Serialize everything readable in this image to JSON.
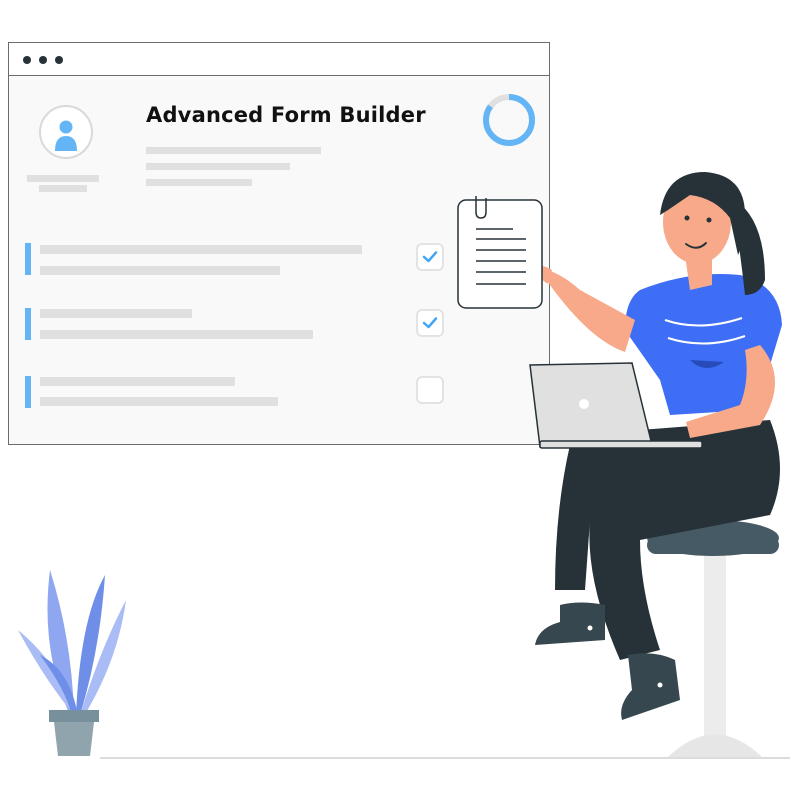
{
  "window": {
    "title": "Advanced Form Builder"
  },
  "form_rows": [
    {
      "checked": true
    },
    {
      "checked": true
    },
    {
      "checked": false
    }
  ],
  "progress": {
    "fraction": 0.85
  },
  "icons": {
    "window_controls": "three-dots",
    "avatar": "user-icon",
    "checkbox_checked": "checkmark-icon",
    "document": "paper-icon",
    "laptop": "laptop-icon",
    "plant": "plant-icon"
  },
  "colors": {
    "accent": "#64b5f6",
    "shirt": "#3d6ef5",
    "dark": "#263238",
    "placeholder_bar": "#e0e0e0"
  }
}
